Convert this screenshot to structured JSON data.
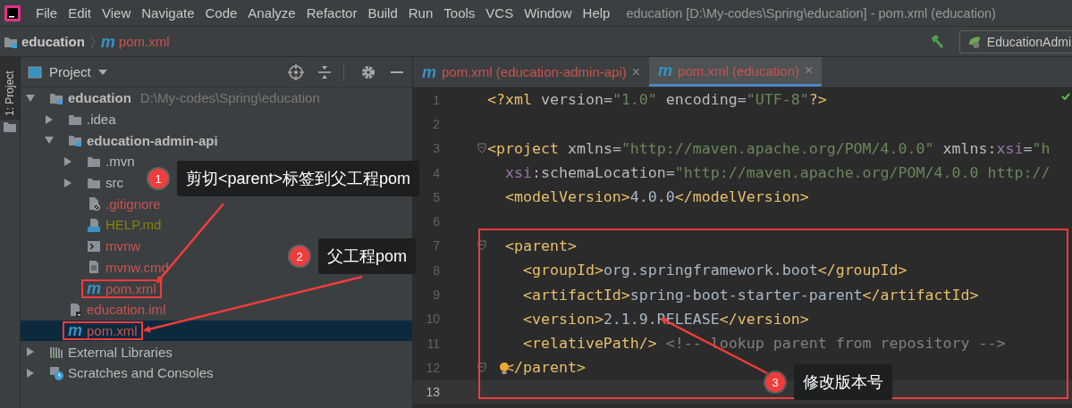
{
  "menu": [
    "File",
    "Edit",
    "View",
    "Navigate",
    "Code",
    "Analyze",
    "Refactor",
    "Build",
    "Run",
    "Tools",
    "VCS",
    "Window",
    "Help"
  ],
  "window": {
    "title": "education [D:\\My-codes\\Spring\\education] - pom.xml (education)"
  },
  "breadcrumbs": [
    {
      "label": "education",
      "kind": "module"
    },
    {
      "label": "pom.xml",
      "kind": "maven",
      "icon": "m"
    }
  ],
  "run_config": {
    "label": "EducationAdmi"
  },
  "side_strip": {
    "label": "1: Project"
  },
  "project_panel": {
    "title": "Project"
  },
  "tree": [
    {
      "label": "education",
      "kind": "module",
      "path": "D:\\My-codes\\Spring\\education",
      "expanded": true,
      "color": "#bbbbbb",
      "selected": false,
      "highlighted": false,
      "children": [
        {
          "label": ".idea",
          "kind": "folder",
          "expanded": false,
          "color": "#bbbbbb",
          "selected": false,
          "highlighted": false
        },
        {
          "label": "education-admin-api",
          "kind": "module",
          "expanded": true,
          "color": "#bbbbbb",
          "selected": false,
          "highlighted": false,
          "children": [
            {
              "label": ".mvn",
              "kind": "folder",
              "expanded": false,
              "color": "#bbbbbb",
              "selected": false,
              "highlighted": false
            },
            {
              "label": "src",
              "kind": "folder",
              "expanded": false,
              "color": "#bbbbbb",
              "selected": false,
              "highlighted": false
            },
            {
              "label": ".gitignore",
              "kind": "gitignore",
              "color": "#c75450",
              "selected": false,
              "highlighted": false
            },
            {
              "label": "HELP.md",
              "kind": "markdown",
              "color": "#848504",
              "selected": false,
              "highlighted": false
            },
            {
              "label": "mvnw",
              "kind": "script",
              "color": "#c75450",
              "selected": false,
              "highlighted": false
            },
            {
              "label": "mvnw.cmd",
              "kind": "text",
              "color": "#c75450",
              "selected": false,
              "highlighted": false
            },
            {
              "label": "pom.xml",
              "kind": "maven",
              "icon": "m",
              "color": "#c75450",
              "selected": false,
              "highlighted": true
            }
          ]
        },
        {
          "label": "education.iml",
          "kind": "iml",
          "color": "#c75450",
          "selected": false,
          "highlighted": false
        },
        {
          "label": "pom.xml",
          "kind": "maven",
          "icon": "m",
          "color": "#c75450",
          "selected": true,
          "highlighted": true
        }
      ]
    },
    {
      "label": "External Libraries",
      "kind": "libraries",
      "expanded": false,
      "color": "#bbbbbb",
      "selected": false,
      "highlighted": false
    },
    {
      "label": "Scratches and Consoles",
      "kind": "scratches",
      "expanded": false,
      "color": "#bbbbbb",
      "selected": false,
      "highlighted": false
    }
  ],
  "tabs": [
    {
      "label": "pom.xml (education-admin-api)",
      "icon": "m",
      "close": "×",
      "selected": false
    },
    {
      "label": "pom.xml (education)",
      "icon": "m",
      "close": "×",
      "selected": true
    }
  ],
  "editor": {
    "lines": [
      {
        "number": "1",
        "tokens": [
          {
            "kind": "tag",
            "text": "<?xml "
          },
          {
            "kind": "attr",
            "text": "version"
          },
          {
            "kind": "plain",
            "text": "="
          },
          {
            "kind": "string",
            "text": "\"1.0\""
          },
          {
            "kind": "attr",
            "text": " encoding"
          },
          {
            "kind": "plain",
            "text": "="
          },
          {
            "kind": "string",
            "text": "\"UTF-8\""
          },
          {
            "kind": "tag",
            "text": "?>"
          }
        ],
        "fold": false,
        "bulb": false,
        "current": false
      },
      {
        "number": "2",
        "fold": false,
        "bulb": false,
        "current": false
      },
      {
        "number": "3",
        "tokens": [
          {
            "kind": "tag",
            "text": "<project "
          },
          {
            "kind": "attr",
            "text": "xmlns"
          },
          {
            "kind": "plain",
            "text": "="
          },
          {
            "kind": "string",
            "text": "\"http://maven.apache.org/POM/4.0.0\""
          },
          {
            "kind": "attr",
            "text": " xmlns:"
          },
          {
            "kind": "ns",
            "text": "xsi"
          },
          {
            "kind": "plain",
            "text": "="
          },
          {
            "kind": "string",
            "text": "\"h"
          }
        ],
        "fold": true,
        "bulb": false,
        "current": false
      },
      {
        "number": "4",
        "tokens": [
          {
            "kind": "ns",
            "text": "  xsi"
          },
          {
            "kind": "attr",
            "text": ":schemaLocation"
          },
          {
            "kind": "plain",
            "text": "="
          },
          {
            "kind": "string",
            "text": "\"http://maven.apache.org/POM/4.0.0 http://"
          }
        ],
        "fold": false,
        "bulb": false,
        "current": false
      },
      {
        "number": "5",
        "tokens": [
          {
            "kind": "tag",
            "text": "  <modelVersion>"
          },
          {
            "kind": "plain",
            "text": "4.0.0"
          },
          {
            "kind": "tag",
            "text": "</modelVersion>"
          }
        ],
        "fold": false,
        "bulb": false,
        "current": false
      },
      {
        "number": "6",
        "fold": false,
        "bulb": false,
        "current": false
      }
    ],
    "boxed_lines": [
      {
        "number": "7",
        "tokens": [
          {
            "kind": "tag",
            "text": "  <parent>"
          }
        ],
        "fold": true,
        "bulb": false,
        "current": false
      },
      {
        "number": "8",
        "tokens": [
          {
            "kind": "tag",
            "text": "    <groupId>"
          },
          {
            "kind": "plain",
            "text": "org.springframework.boot"
          },
          {
            "kind": "tag",
            "text": "</groupId>"
          }
        ],
        "fold": false,
        "bulb": false,
        "current": false
      },
      {
        "number": "9",
        "tokens": [
          {
            "kind": "tag",
            "text": "    <artifactId>"
          },
          {
            "kind": "plain",
            "text": "spring-boot-starter-parent"
          },
          {
            "kind": "tag",
            "text": "</artifactId>"
          }
        ],
        "fold": false,
        "bulb": false,
        "current": false
      },
      {
        "number": "10",
        "tokens": [
          {
            "kind": "tag",
            "text": "    <version>"
          },
          {
            "kind": "plain",
            "text": "2.1.9.RELEASE"
          },
          {
            "kind": "tag",
            "text": "</version>"
          }
        ],
        "fold": false,
        "bulb": false,
        "current": false
      },
      {
        "number": "11",
        "tokens": [
          {
            "kind": "tag",
            "text": "    <relativePath/>"
          },
          {
            "kind": "comment",
            "text": " <!-- lookup parent from repository -->"
          }
        ],
        "fold": false,
        "bulb": false,
        "current": false
      },
      {
        "number": "12",
        "tokens": [
          {
            "kind": "tag",
            "text": "  </parent>"
          }
        ],
        "fold": true,
        "bulb": true,
        "current": false
      },
      {
        "number": "13",
        "fold": false,
        "bulb": false,
        "current": true
      }
    ]
  },
  "callouts": [
    {
      "number": "1",
      "text": "剪切<parent>标签到父工程pom"
    },
    {
      "number": "2",
      "text": "父工程pom"
    },
    {
      "number": "3",
      "text": "修改版本号"
    }
  ]
}
